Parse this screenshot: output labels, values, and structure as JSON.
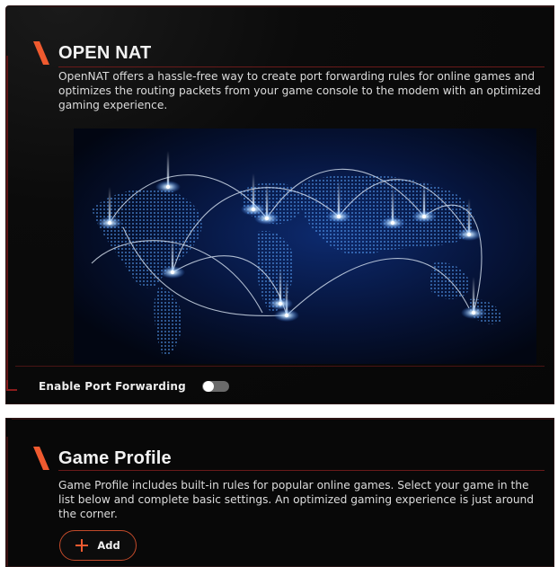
{
  "open_nat": {
    "title": "OPEN NAT",
    "description": "OpenNAT offers a hassle-free way to create port forwarding rules for online games and optimizes the routing packets from your game console to the modem with an optimized gaming experience.",
    "port_forwarding_label": "Enable Port Forwarding",
    "port_forwarding_enabled": false
  },
  "game_profile": {
    "title": "Game Profile",
    "description": "Game Profile includes built-in rules for popular online games. Select your game in the list below and complete basic settings. An optimized gaming experience is just around the corner.",
    "add_label": "Add"
  },
  "colors": {
    "accent": "#ef5a2f",
    "panel_bg": "#0a0a0a",
    "border_red": "#6a1a1a",
    "map_blue": "#3c8cff"
  },
  "icons": {
    "title_marker": "orange-slash-icon",
    "add": "plus-icon",
    "map": "world-map-network-illustration"
  }
}
